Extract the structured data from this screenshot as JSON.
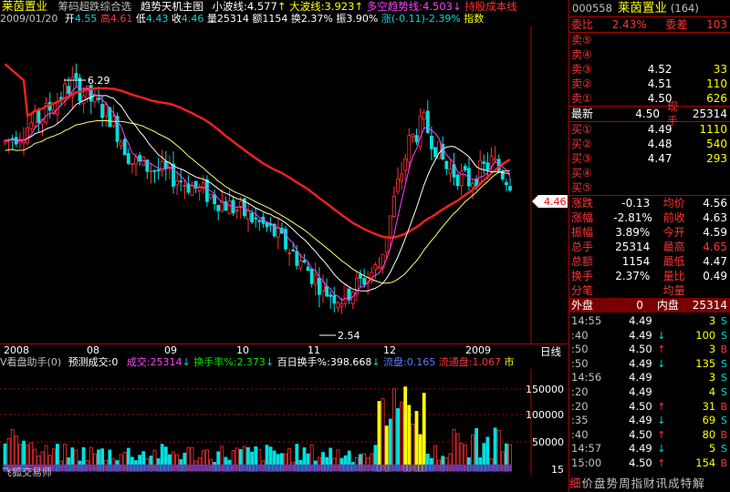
{
  "top": {
    "stock_name": "莱茵置业",
    "indicator_menu": "筹码超跌综合选",
    "main_chart": "趋势天机主图",
    "small_wave_label": "小波线:",
    "small_wave_value": "4.577",
    "big_wave_label": "大波线:",
    "big_wave_value": "3.923",
    "longshort_label": "多空趋势线:",
    "longshort_value": "4.503",
    "cost_label": "持股成本线",
    "arrow_up": "↑",
    "arrow_down": "↓"
  },
  "info": {
    "date": "2009/01/20",
    "open_label": "开",
    "open": "4.55",
    "high_label": "高",
    "high": "4.61",
    "low_label": "低",
    "low": "4.43",
    "close_label": "收",
    "close": "4.46",
    "vol_label": "量",
    "vol": "25314",
    "amt_label": "额",
    "amt": "1154",
    "turn_label": "换",
    "turn": "2.37%",
    "amp_label": "振",
    "amp": "3.90%",
    "chg_label": "涨",
    "chg": "(-0.11)-2.39%",
    "index_label": "指数"
  },
  "price_chart": {
    "high_mark": "6.29",
    "low_mark": "2.54",
    "current_price_tag": "4.46",
    "x_labels": [
      "2008",
      "08",
      "09",
      "10",
      "11",
      "12",
      "2009"
    ],
    "period": "日线"
  },
  "vol_panel": {
    "title": "V看盘助手(0)",
    "pred_label": "预测成交:",
    "pred_value": "0",
    "vol_label": "成交:",
    "vol_value": "25314",
    "turn_label": "换手率%:",
    "turn_value": "2.373",
    "hundred_label": "百日换手%:",
    "hundred_value": "398.668",
    "float_label": "流盘:",
    "float_value": "0.165",
    "circ_label": "流通盘:",
    "circ_value": "1.067",
    "market_label": "市",
    "y_labels": [
      "150000",
      "100000",
      "50000",
      "15"
    ],
    "watermark": "飞狐交易师"
  },
  "quote": {
    "code": "000558",
    "name": "莱茵置业",
    "num": "(164)",
    "weibi_label": "委比",
    "weibi": "2.43%",
    "weicha_label": "委差",
    "weicha": "103",
    "sells": [
      {
        "label": "卖⑤",
        "price": "",
        "qty": ""
      },
      {
        "label": "卖④",
        "price": "",
        "qty": ""
      },
      {
        "label": "卖③",
        "price": "4.52",
        "qty": "33"
      },
      {
        "label": "卖②",
        "price": "4.51",
        "qty": "110"
      },
      {
        "label": "卖①",
        "price": "4.50",
        "qty": "626"
      }
    ],
    "latest_label": "最新",
    "latest": "4.50",
    "xianshou_label": "现手",
    "xianshou": "25314",
    "buys": [
      {
        "label": "买①",
        "price": "4.49",
        "qty": "1110"
      },
      {
        "label": "买②",
        "price": "4.48",
        "qty": "540"
      },
      {
        "label": "买③",
        "price": "4.47",
        "qty": "293"
      },
      {
        "label": "买④",
        "price": "",
        "qty": ""
      },
      {
        "label": "买⑤",
        "price": "",
        "qty": ""
      }
    ],
    "stats": [
      {
        "l1": "涨跌",
        "v1": "-0.13",
        "c1": "#ffffff",
        "l2": "均价",
        "v2": "4.56",
        "c2": "#ffffff"
      },
      {
        "l1": "涨幅",
        "v1": "-2.81%",
        "c1": "#ffffff",
        "l2": "前收",
        "v2": "4.63",
        "c2": "#ffffff"
      },
      {
        "l1": "振幅",
        "v1": "3.89%",
        "c1": "#ffffff",
        "l2": "今开",
        "v2": "4.59",
        "c2": "#ffffff"
      },
      {
        "l1": "总手",
        "v1": "25314",
        "c1": "#ffffff",
        "l2": "最高",
        "v2": "4.65",
        "c2": "#ff3232"
      },
      {
        "l1": "总额",
        "v1": "1154",
        "c1": "#ffffff",
        "l2": "最低",
        "v2": "4.47",
        "c2": "#ffffff"
      },
      {
        "l1": "换手",
        "v1": "2.37%",
        "c1": "#ffffff",
        "l2": "量比",
        "v2": "0.49",
        "c2": "#ffffff"
      },
      {
        "l1": "分笔",
        "v1": "",
        "c1": "#ffffff",
        "l2": "均量",
        "v2": "",
        "c2": "#ffffff"
      }
    ],
    "waipan_label": "外盘",
    "waipan": "0",
    "neipan_label": "内盘",
    "neipan": "25314"
  },
  "ticks": [
    {
      "time": "14:55",
      "price": "4.49",
      "arrow": "",
      "qty": "3",
      "side": "S"
    },
    {
      "time": ":40",
      "price": "4.49",
      "arrow": "↓",
      "qty": "100",
      "side": "S"
    },
    {
      "time": ":50",
      "price": "4.50",
      "arrow": "↑",
      "qty": "3",
      "side": "B"
    },
    {
      "time": ":50",
      "price": "4.49",
      "arrow": "↓",
      "qty": "135",
      "side": "S"
    },
    {
      "time": "14:56",
      "price": "4.49",
      "arrow": "",
      "qty": "3",
      "side": "S"
    },
    {
      "time": ":20",
      "price": "4.49",
      "arrow": "",
      "qty": "4",
      "side": "S"
    },
    {
      "time": ":20",
      "price": "4.50",
      "arrow": "↑",
      "qty": "31",
      "side": "B"
    },
    {
      "time": ":35",
      "price": "4.49",
      "arrow": "↓",
      "qty": "69",
      "side": "S"
    },
    {
      "time": ":40",
      "price": "4.50",
      "arrow": "↑",
      "qty": "80",
      "side": "B"
    },
    {
      "time": "14:57",
      "price": "4.49",
      "arrow": "↓",
      "qty": "5",
      "side": "S"
    },
    {
      "time": "15:00",
      "price": "4.50",
      "arrow": "↑",
      "qty": "154",
      "side": "B"
    }
  ],
  "footer": {
    "items": [
      "细",
      "价",
      "盘",
      "势",
      "周",
      "指",
      "财",
      "讯",
      "成",
      "特",
      "解"
    ]
  },
  "colors": {
    "up": "#ff3232",
    "down": "#00e0e0",
    "ma_red": "#ff2020",
    "ma_yellow": "#ffff70",
    "ma_white": "#ffffff",
    "ma_magenta": "#ff40ff",
    "grid": "#b00000"
  }
}
